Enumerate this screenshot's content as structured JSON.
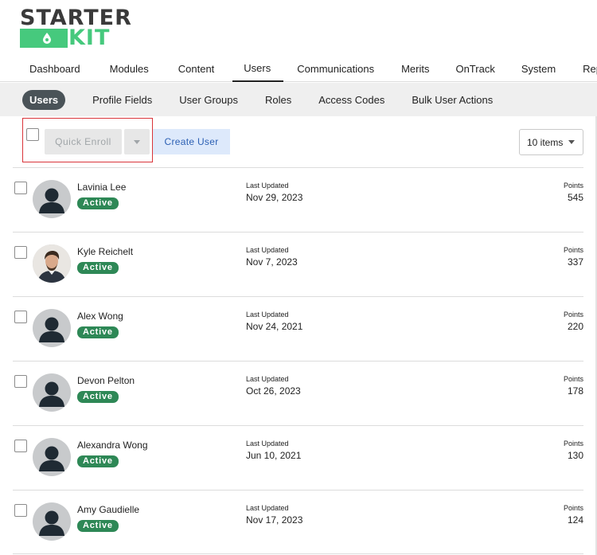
{
  "brand": {
    "logo_top": "STARTER",
    "logo_bottom": "KIT",
    "green": "#46c97d",
    "dark": "#3a3a3a"
  },
  "topnav": {
    "items": [
      "Dashboard",
      "Modules",
      "Content",
      "Users",
      "Communications",
      "Merits",
      "OnTrack",
      "System",
      "Rep"
    ],
    "active": "Users"
  },
  "subnav": {
    "items": [
      "Users",
      "Profile Fields",
      "User Groups",
      "Roles",
      "Access Codes",
      "Bulk User Actions"
    ],
    "active": "Users"
  },
  "toolbar": {
    "quick_enroll_label": "Quick Enroll",
    "create_user_label": "Create User",
    "items_per_page": "10 items"
  },
  "labels": {
    "last_updated": "Last Updated",
    "points": "Points"
  },
  "users": [
    {
      "name": "Lavinia Lee",
      "status": "Active",
      "updated": "Nov 29, 2023",
      "points": "545",
      "avatar": "placeholder"
    },
    {
      "name": "Kyle Reichelt",
      "status": "Active",
      "updated": "Nov 7, 2023",
      "points": "337",
      "avatar": "photo"
    },
    {
      "name": "Alex Wong",
      "status": "Active",
      "updated": "Nov 24, 2021",
      "points": "220",
      "avatar": "placeholder"
    },
    {
      "name": "Devon Pelton",
      "status": "Active",
      "updated": "Oct 26, 2023",
      "points": "178",
      "avatar": "placeholder"
    },
    {
      "name": "Alexandra Wong",
      "status": "Active",
      "updated": "Jun 10, 2021",
      "points": "130",
      "avatar": "placeholder"
    },
    {
      "name": "Amy Gaudielle",
      "status": "Active",
      "updated": "Nov 17, 2023",
      "points": "124",
      "avatar": "placeholder"
    }
  ],
  "colors": {
    "active_badge": "#2e8856",
    "subnav_active_bg": "#4a5358",
    "create_user_bg": "#dde9fb",
    "create_user_text": "#2c60b4",
    "highlight_border": "#d9343a"
  }
}
